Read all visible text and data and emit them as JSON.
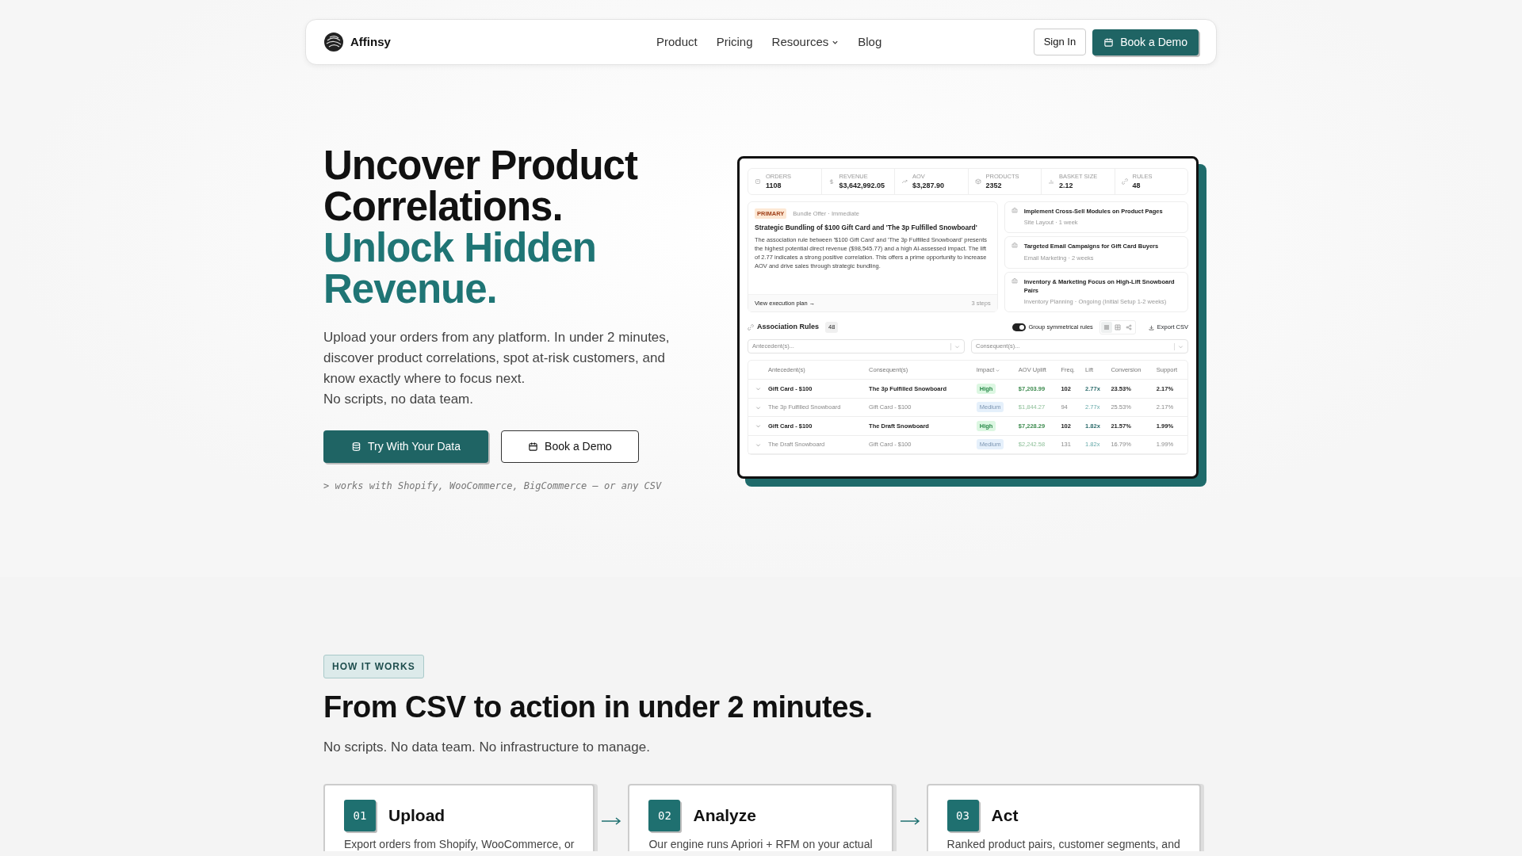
{
  "nav": {
    "brand": "Affinsy",
    "links": [
      {
        "label": "Product",
        "dropdown": false
      },
      {
        "label": "Pricing",
        "dropdown": false
      },
      {
        "label": "Resources",
        "dropdown": true
      },
      {
        "label": "Blog",
        "dropdown": false
      }
    ],
    "sign_in": "Sign In",
    "cta": "Book a Demo"
  },
  "hero": {
    "title": "Uncover Product Correlations.",
    "accent": "Unlock Hidden Revenue.",
    "paragraphs": [
      "Upload your orders from any platform. In under 2 minutes, discover product correlations, spot at-risk customers, and know exactly where to focus next.",
      "No scripts, no data team."
    ],
    "primary_button": "Try With Your Data",
    "secondary_button": "Book a Demo",
    "footnote": "> works with Shopify, WooCommerce, BigCommerce — or any CSV"
  },
  "dashboard": {
    "stats": [
      {
        "label": "ORDERS",
        "value": "1108"
      },
      {
        "label": "REVENUE",
        "value": "$3,642,992.05"
      },
      {
        "label": "AOV",
        "value": "$3,287.90"
      },
      {
        "label": "PRODUCTS",
        "value": "2352"
      },
      {
        "label": "BASKET SIZE",
        "value": "2.12"
      },
      {
        "label": "RULES",
        "value": "48"
      }
    ],
    "primary": {
      "tag": "PRIMARY",
      "meta": "Bundle Offer · Immediate",
      "title": "Strategic Bundling of $100 Gift Card and 'The 3p Fulfilled Snowboard'",
      "body": "The association rule between '$100 Gift Card' and 'The 3p Fulfilled Snowboard' presents the highest potential direct revenue ($98,545.77) and a high AI-assessed impact. The lift of 2.77 indicates a strong positive correlation. This offers a prime opportunity to increase AOV and drive sales through strategic bundling.",
      "link": "View execution plan →",
      "steps": "3 steps"
    },
    "actions": [
      {
        "title": "Implement Cross-Sell Modules on Product Pages",
        "meta": "Site Layout · 1 week"
      },
      {
        "title": "Targeted Email Campaigns for Gift Card Buyers",
        "meta": "Email Marketing · 2 weeks"
      },
      {
        "title": "Inventory & Marketing Focus on High-Lift Snowboard Pairs",
        "meta": "Inventory Planning · Ongoing (Initial Setup 1-2 weeks)"
      }
    ],
    "rules": {
      "title": "Association Rules",
      "count": "48",
      "toggle": {
        "label": "Group symmetrical rules",
        "on": true
      },
      "views": [
        {
          "selected": true
        },
        {
          "selected": false
        },
        {
          "selected": false
        }
      ],
      "export": "Export CSV",
      "filters": [
        {
          "placeholder": "Antecedent(s)..."
        },
        {
          "placeholder": "Consequent(s)..."
        }
      ],
      "columns": [
        {
          "label": "Antecedent(s)",
          "sorted": false
        },
        {
          "label": "Consequent(s)",
          "sorted": false
        },
        {
          "label": "Impact",
          "sorted": true
        },
        {
          "label": "AOV Uplift",
          "sorted": false
        },
        {
          "label": "Freq.",
          "sorted": false
        },
        {
          "label": "Lift",
          "sorted": false
        },
        {
          "label": "Conversion",
          "sorted": false
        },
        {
          "label": "Support",
          "sorted": false
        }
      ],
      "rows": [
        {
          "kind": "rule",
          "cells": [
            "Gift Card - $100",
            "The 3p Fulfilled Snowboard",
            "High",
            "$7,203.99",
            "102",
            "2.77x",
            "23.53%",
            "2.17%"
          ]
        },
        {
          "kind": "reverse",
          "cells": [
            "The 3p Fulfilled Snowboard",
            "Gift Card - $100",
            "Medium",
            "$1,844.27",
            "94",
            "2.77x",
            "25.53%",
            "2.17%"
          ]
        },
        {
          "kind": "rule",
          "cells": [
            "Gift Card - $100",
            "The Draft Snowboard",
            "High",
            "$7,228.29",
            "102",
            "1.82x",
            "21.57%",
            "1.99%"
          ]
        },
        {
          "kind": "reverse",
          "cells": [
            "The Draft Snowboard",
            "Gift Card - $100",
            "Medium",
            "$2,242.58",
            "131",
            "1.82x",
            "16.79%",
            "1.99%"
          ]
        }
      ]
    }
  },
  "how": {
    "badge": "HOW IT WORKS",
    "heading": "From CSV to action in under 2 minutes.",
    "sub": "No scripts. No data team. No infrastructure to manage.",
    "steps": [
      {
        "num": "01",
        "title": "Upload",
        "text": "Export orders from Shopify, WooCommerce, or"
      },
      {
        "num": "02",
        "title": "Analyze",
        "text": "Our engine runs Apriori + RFM on your actual"
      },
      {
        "num": "03",
        "title": "Act",
        "text": "Ranked product pairs, customer segments, and"
      }
    ]
  }
}
